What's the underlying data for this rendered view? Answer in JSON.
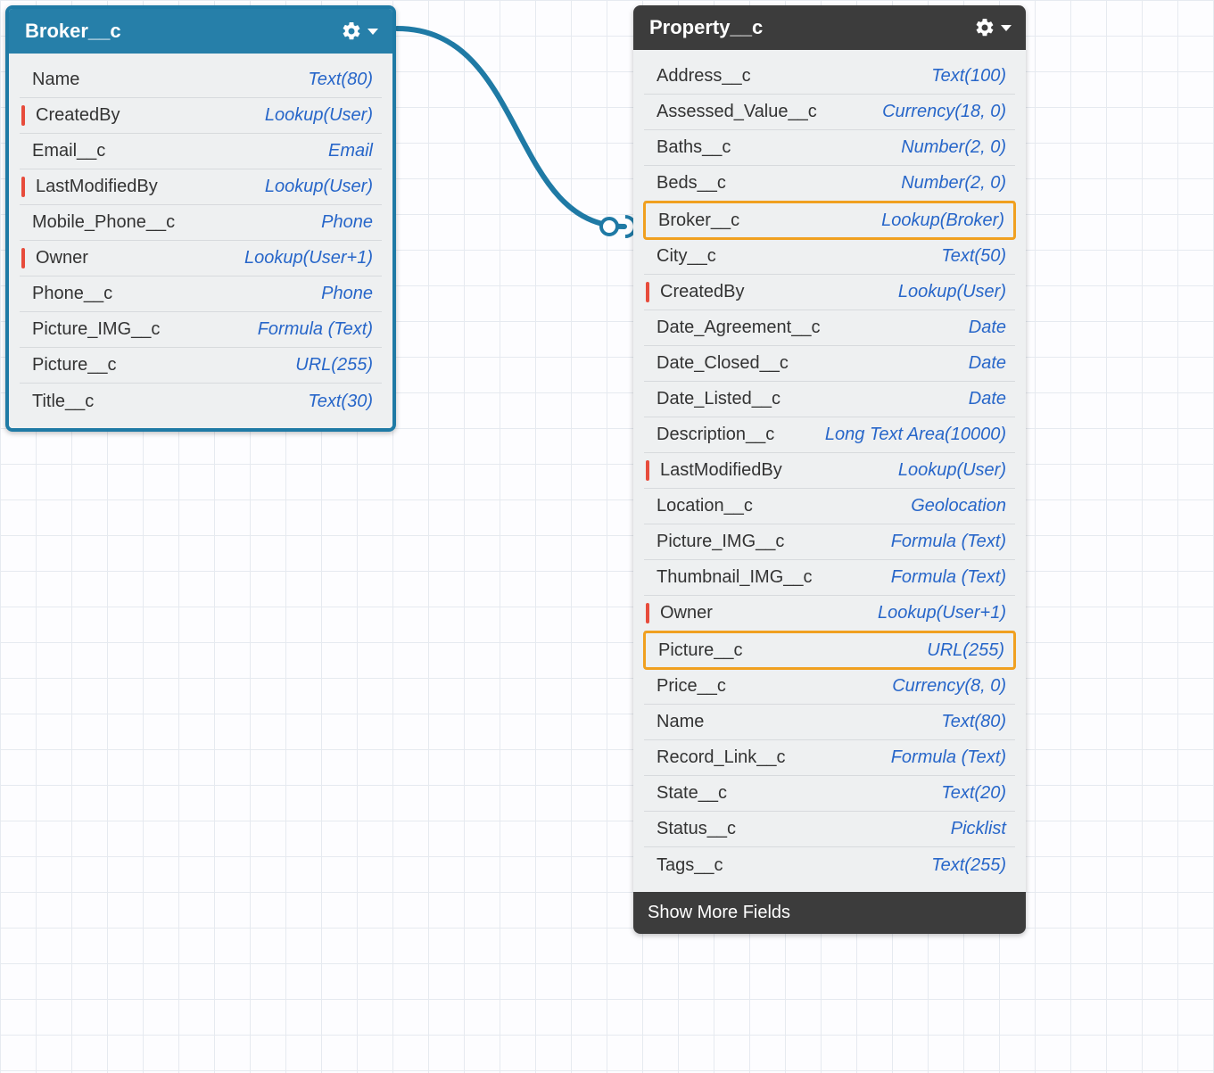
{
  "broker": {
    "title": "Broker__c",
    "fields": [
      {
        "name": "Name",
        "type": "Text(80)",
        "red": false,
        "hl": false
      },
      {
        "name": "CreatedBy",
        "type": "Lookup(User)",
        "red": true,
        "hl": false
      },
      {
        "name": "Email__c",
        "type": "Email",
        "red": false,
        "hl": false
      },
      {
        "name": "LastModifiedBy",
        "type": "Lookup(User)",
        "red": true,
        "hl": false
      },
      {
        "name": "Mobile_Phone__c",
        "type": "Phone",
        "red": false,
        "hl": false
      },
      {
        "name": "Owner",
        "type": "Lookup(User+1)",
        "red": true,
        "hl": false
      },
      {
        "name": "Phone__c",
        "type": "Phone",
        "red": false,
        "hl": false
      },
      {
        "name": "Picture_IMG__c",
        "type": "Formula (Text)",
        "red": false,
        "hl": false
      },
      {
        "name": "Picture__c",
        "type": "URL(255)",
        "red": false,
        "hl": false
      },
      {
        "name": "Title__c",
        "type": "Text(30)",
        "red": false,
        "hl": false
      }
    ]
  },
  "property": {
    "title": "Property__c",
    "fields": [
      {
        "name": "Address__c",
        "type": "Text(100)",
        "red": false,
        "hl": false
      },
      {
        "name": "Assessed_Value__c",
        "type": "Currency(18, 0)",
        "red": false,
        "hl": false
      },
      {
        "name": "Baths__c",
        "type": "Number(2, 0)",
        "red": false,
        "hl": false
      },
      {
        "name": "Beds__c",
        "type": "Number(2, 0)",
        "red": false,
        "hl": false
      },
      {
        "name": "Broker__c",
        "type": "Lookup(Broker)",
        "red": false,
        "hl": true
      },
      {
        "name": "City__c",
        "type": "Text(50)",
        "red": false,
        "hl": false
      },
      {
        "name": "CreatedBy",
        "type": "Lookup(User)",
        "red": true,
        "hl": false
      },
      {
        "name": "Date_Agreement__c",
        "type": "Date",
        "red": false,
        "hl": false
      },
      {
        "name": "Date_Closed__c",
        "type": "Date",
        "red": false,
        "hl": false
      },
      {
        "name": "Date_Listed__c",
        "type": "Date",
        "red": false,
        "hl": false
      },
      {
        "name": "Description__c",
        "type": "Long Text Area(10000)",
        "red": false,
        "hl": false
      },
      {
        "name": "LastModifiedBy",
        "type": "Lookup(User)",
        "red": true,
        "hl": false
      },
      {
        "name": "Location__c",
        "type": "Geolocation",
        "red": false,
        "hl": false
      },
      {
        "name": "Picture_IMG__c",
        "type": "Formula (Text)",
        "red": false,
        "hl": false
      },
      {
        "name": "Thumbnail_IMG__c",
        "type": "Formula (Text)",
        "red": false,
        "hl": false
      },
      {
        "name": "Owner",
        "type": "Lookup(User+1)",
        "red": true,
        "hl": false
      },
      {
        "name": "Picture__c",
        "type": "URL(255)",
        "red": false,
        "hl": true
      },
      {
        "name": "Price__c",
        "type": "Currency(8, 0)",
        "red": false,
        "hl": false
      },
      {
        "name": "Name",
        "type": "Text(80)",
        "red": false,
        "hl": false
      },
      {
        "name": "Record_Link__c",
        "type": "Formula (Text)",
        "red": false,
        "hl": false
      },
      {
        "name": "State__c",
        "type": "Text(20)",
        "red": false,
        "hl": false
      },
      {
        "name": "Status__c",
        "type": "Picklist",
        "red": false,
        "hl": false
      },
      {
        "name": "Tags__c",
        "type": "Text(255)",
        "red": false,
        "hl": false
      }
    ],
    "footer": "Show More Fields"
  }
}
